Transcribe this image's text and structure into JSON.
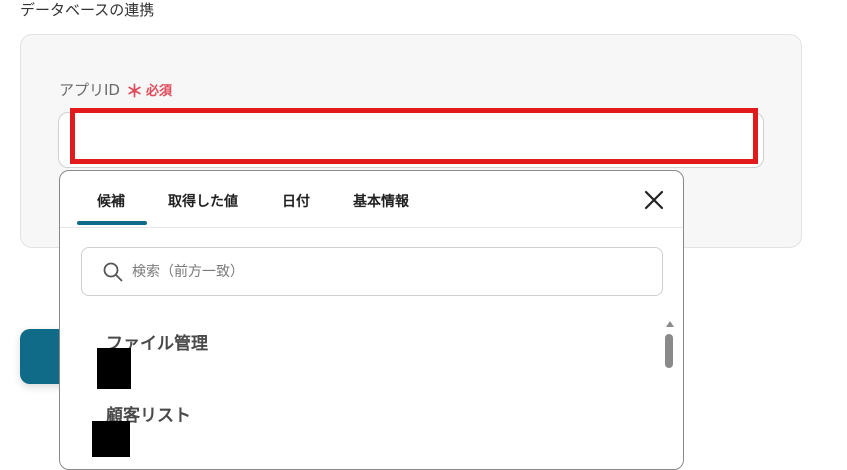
{
  "section": {
    "title": "データベースの連携"
  },
  "field": {
    "label": "アプリID",
    "required_mark": "＊",
    "required_text": "必須",
    "value": ""
  },
  "dropdown": {
    "tabs": [
      {
        "label": "候補",
        "active": true
      },
      {
        "label": "取得した値",
        "active": false
      },
      {
        "label": "日付",
        "active": false
      },
      {
        "label": "基本情報",
        "active": false
      }
    ],
    "search": {
      "placeholder": "検索（前方一致）"
    },
    "items": [
      {
        "label": "ファイル管理"
      },
      {
        "label": "顧客リスト"
      }
    ]
  },
  "colors": {
    "accent": "#0f6b88",
    "required": "#e04a5a",
    "highlight": "#e11b1b"
  },
  "icons": {
    "close": "close-icon",
    "search": "search-icon"
  }
}
